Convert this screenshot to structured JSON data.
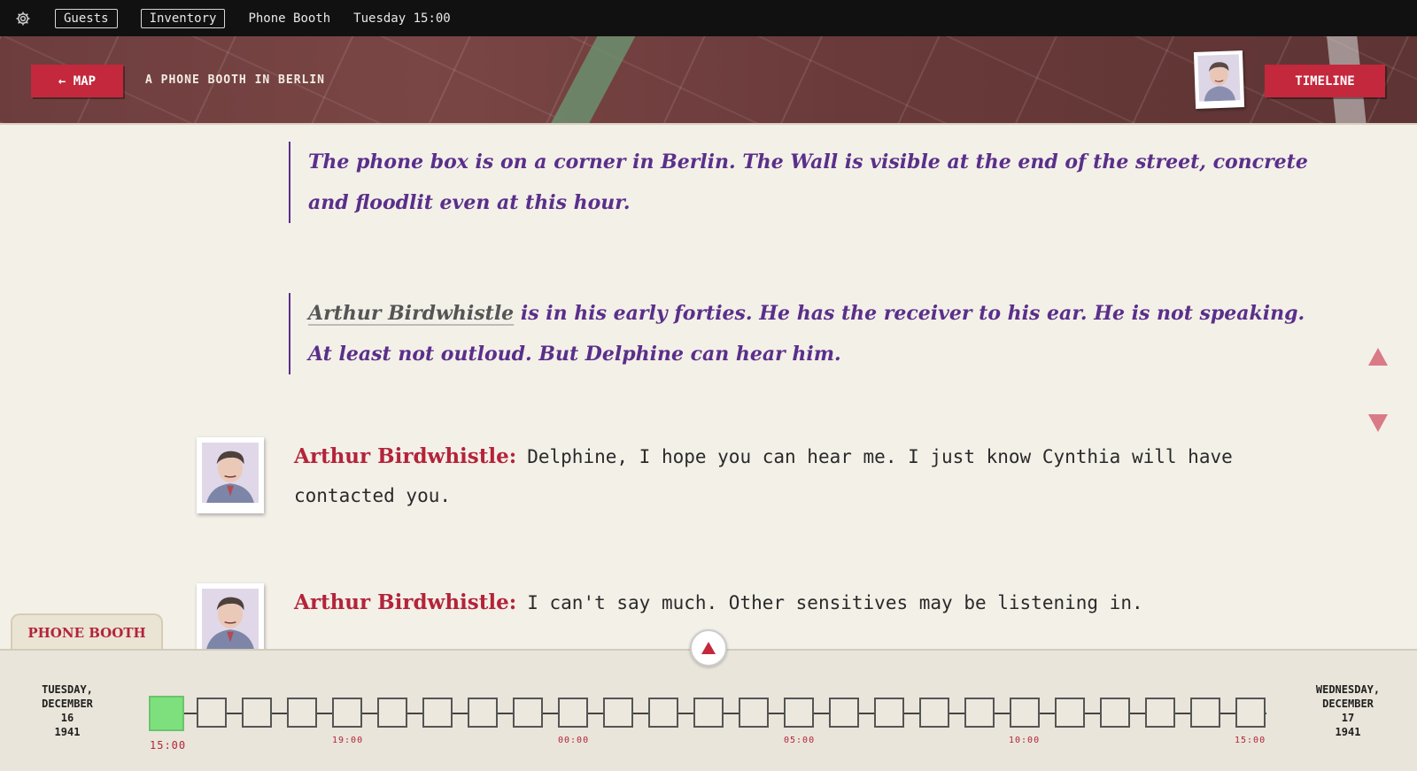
{
  "topbar": {
    "settings_icon": "gear-icon",
    "guests_label": "Guests",
    "inventory_label": "Inventory",
    "location_text": "Phone Booth",
    "time_text": "Tuesday 15:00"
  },
  "header": {
    "map_button": "← MAP",
    "location_title": "A PHONE BOOTH IN BERLIN",
    "timeline_button": "TIMELINE"
  },
  "narration": [
    {
      "text": "The phone box is on a corner in Berlin. The Wall is visible at the end of the street, concrete and floodlit even at this hour."
    },
    {
      "name": "Arthur Birdwhistle",
      "text": " is in his early forties. He has the receiver to his ear. He is not speaking. At least not outloud. But Delphine can hear him."
    }
  ],
  "dialogue": [
    {
      "speaker": "Arthur Birdwhistle:",
      "text": "Delphine, I hope you can hear me. I just know Cynthia will have contacted you."
    },
    {
      "speaker": "Arthur Birdwhistle:",
      "text": "I can't say much. Other sensitives may be listening in."
    }
  ],
  "location_tab": "PHONE BOOTH",
  "timeline": {
    "start_date": [
      "TUESDAY,",
      "DECEMBER",
      "16",
      "1941"
    ],
    "end_date": [
      "WEDNESDAY,",
      "DECEMBER",
      "17",
      "1941"
    ],
    "active_label": "15:00",
    "labels": [
      "19:00",
      "00:00",
      "05:00",
      "10:00",
      "15:00"
    ],
    "slot_count": 25,
    "active_slot": 0
  },
  "colors": {
    "accent_red": "#c4283d",
    "narration_purple": "#5a2f8a",
    "active_slot_green": "#7de07d"
  }
}
